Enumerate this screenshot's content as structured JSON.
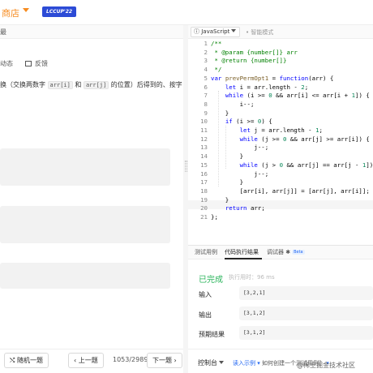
{
  "header": {
    "shop_label": "商店",
    "badge": "LCCUP'22"
  },
  "left": {
    "tab_label": "最",
    "meta_dynamic": "动态",
    "meta_feedback": "反馈",
    "desc_prefix": "换（交换两数字",
    "chip_a": "arr[i]",
    "desc_and": "和",
    "chip_b": "arr[j]",
    "desc_suffix": "的位置）后得到的、按字"
  },
  "editor": {
    "language": "JavaScript",
    "smart_mode": "智能模式",
    "line_numbers": [
      "1",
      "2",
      "3",
      "4",
      "5",
      "6",
      "7",
      "8",
      "9",
      "10",
      "11",
      "12",
      "13",
      "14",
      "15",
      "16",
      "17",
      "18",
      "19",
      "20",
      "21"
    ]
  },
  "console": {
    "tabs": [
      "测试用例",
      "代码执行结果",
      "调试器"
    ],
    "beta": "Beta",
    "status": "已完成",
    "runtime": "执行用时：96 ms",
    "input_label": "输入",
    "input_value": "[3,2,1]",
    "output_label": "输出",
    "output_value": "[3,1,2]",
    "expected_label": "预期结果",
    "expected_value": "[3,1,2]"
  },
  "footer": {
    "random_label": "随机一题",
    "prev_label": "上一题",
    "counter": "1053/2989",
    "next_label": "下一题",
    "console_label": "控制台",
    "example_link": "读入示例",
    "create_test": "如何创建一个测试用例？",
    "watermark": "@稀土掘金技术社区"
  },
  "colors": {
    "accent_orange": "#f68b1f",
    "success_green": "#2db55d",
    "link_blue": "#2468f2",
    "keyword_blue": "#0000ff",
    "comment_green": "#008000"
  }
}
